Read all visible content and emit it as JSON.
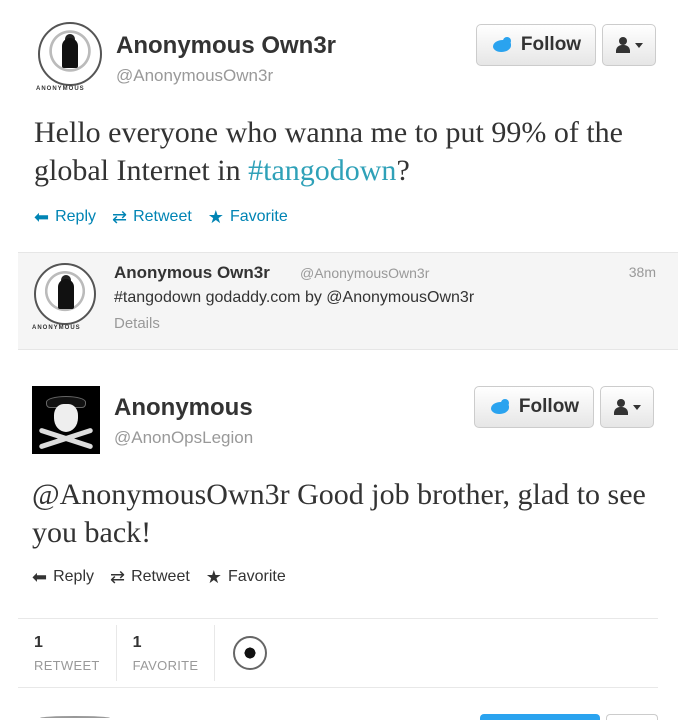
{
  "tweet1": {
    "display_name": "Anonymous Own3r",
    "screen_name": "@AnonymousOwn3r",
    "avatar_caption": "ANONYMOUS",
    "follow_label": "Follow",
    "text_before": "Hello everyone who wanna me to put 99% of the global Internet in ",
    "hashtag": "#tangodown",
    "text_after": "?",
    "actions": {
      "reply": "Reply",
      "retweet": "Retweet",
      "favorite": "Favorite"
    },
    "quoted": {
      "display_name": "Anonymous Own3r",
      "screen_name": "@AnonymousOwn3r",
      "time": "38m",
      "text": "#tangodown godaddy.com by @AnonymousOwn3r",
      "details": "Details",
      "avatar_caption": "ANONYMOUS"
    }
  },
  "tweet2": {
    "display_name": "Anonymous",
    "screen_name": "@AnonOpsLegion",
    "follow_label": "Follow",
    "text": "@AnonymousOwn3r Good job brother, glad to see you back!",
    "actions": {
      "reply": "Reply",
      "retweet": "Retweet",
      "favorite": "Favorite"
    },
    "stats": {
      "retweets": "1",
      "retweet_label": "RETWEET",
      "favorites": "1",
      "favorite_label": "FAVORITE"
    }
  },
  "colors": {
    "link": "#0084b4",
    "hashtag": "#2fa1b8",
    "twitter_blue": "#2aa3ef"
  }
}
